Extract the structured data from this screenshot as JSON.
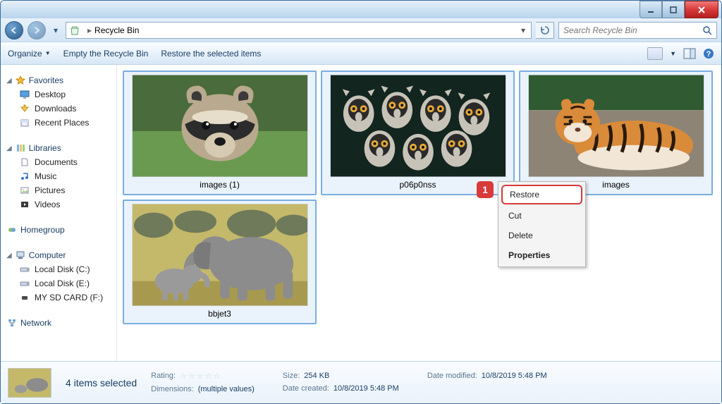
{
  "window": {
    "location": "Recycle Bin",
    "search_placeholder": "Search Recycle Bin"
  },
  "commands": {
    "organize": "Organize",
    "empty": "Empty the Recycle Bin",
    "restore": "Restore the selected items"
  },
  "sidebar": {
    "favorites": {
      "label": "Favorites",
      "items": [
        "Desktop",
        "Downloads",
        "Recent Places"
      ]
    },
    "libraries": {
      "label": "Libraries",
      "items": [
        "Documents",
        "Music",
        "Pictures",
        "Videos"
      ]
    },
    "homegroup": {
      "label": "Homegroup"
    },
    "computer": {
      "label": "Computer",
      "items": [
        "Local Disk (C:)",
        "Local Disk (E:)",
        "MY SD CARD (F:)"
      ]
    },
    "network": {
      "label": "Network"
    }
  },
  "items": [
    {
      "name": "images (1)"
    },
    {
      "name": "p06p0nss"
    },
    {
      "name": "images"
    },
    {
      "name": "bbjet3"
    }
  ],
  "context_menu": {
    "restore": "Restore",
    "cut": "Cut",
    "delete": "Delete",
    "properties": "Properties",
    "callout": "1"
  },
  "details": {
    "selection": "4 items selected",
    "rating_label": "Rating:",
    "dimensions_label": "Dimensions:",
    "dimensions_value": "(multiple values)",
    "size_label": "Size:",
    "size_value": "254 KB",
    "created_label": "Date created:",
    "created_value": "10/8/2019 5:48 PM",
    "modified_label": "Date modified:",
    "modified_value": "10/8/2019 5:48 PM"
  }
}
